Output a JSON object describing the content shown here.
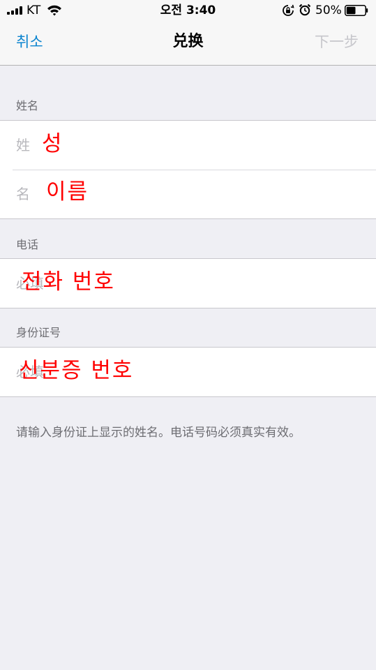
{
  "status_bar": {
    "carrier": "KT",
    "time": "오전 3:40",
    "battery_percent": "50%",
    "battery_level": 0.5,
    "icons": [
      "signal-icon",
      "wifi-icon",
      "rotation-lock-icon",
      "alarm-icon",
      "battery-icon"
    ]
  },
  "nav": {
    "cancel_label": "취소",
    "title": "兑换",
    "next_label": "下一步"
  },
  "sections": {
    "name": {
      "header": "姓名",
      "last_name_label": "姓",
      "last_name_value": "성",
      "first_name_label": "名",
      "first_name_value": "이름"
    },
    "phone": {
      "header": "电话",
      "placeholder": "必填",
      "value": "전화 번호"
    },
    "id": {
      "header": "身份证号",
      "placeholder": "必填",
      "value": "신분증 번호"
    }
  },
  "footer_note": "请输入身份证上显示的姓名。电话号码必须真实有效。",
  "colors": {
    "accent": "#0b84cf",
    "disabled": "#c6c6cb",
    "annotation": "#ff0000",
    "background": "#efeff4"
  }
}
